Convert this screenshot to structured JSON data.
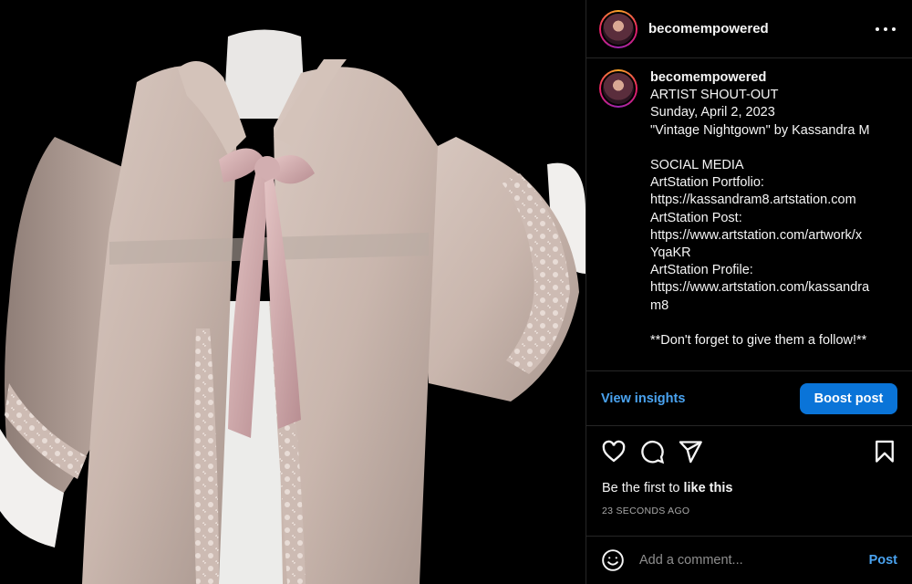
{
  "post": {
    "username": "becomempowered"
  },
  "caption": {
    "username": "becomempowered",
    "lines": [
      "ARTIST SHOUT-OUT",
      "Sunday, April 2, 2023",
      "\"Vintage Nightgown\" by Kassandra M",
      "",
      "SOCIAL MEDIA",
      "ArtStation Portfolio:",
      "https://kassandram8.artstation.com",
      "ArtStation Post:",
      "https://www.artstation.com/artwork/x",
      "YqaKR",
      "ArtStation Profile:",
      "https://www.artstation.com/kassandra",
      "m8",
      "",
      "**Don't forget to give them a follow!**"
    ]
  },
  "insights": {
    "view_label": "View insights",
    "boost_label": "Boost post"
  },
  "actions": {
    "icons": [
      "heart-icon",
      "comment-icon",
      "share-icon",
      "bookmark-icon"
    ]
  },
  "likes": {
    "prefix": "Be the first to ",
    "link": "like this"
  },
  "timestamp": "23 SECONDS AGO",
  "comment": {
    "placeholder": "Add a comment...",
    "post_label": "Post"
  },
  "colors": {
    "accent": "#0a74d8",
    "link": "#4aa3f0",
    "divider": "#262626"
  }
}
